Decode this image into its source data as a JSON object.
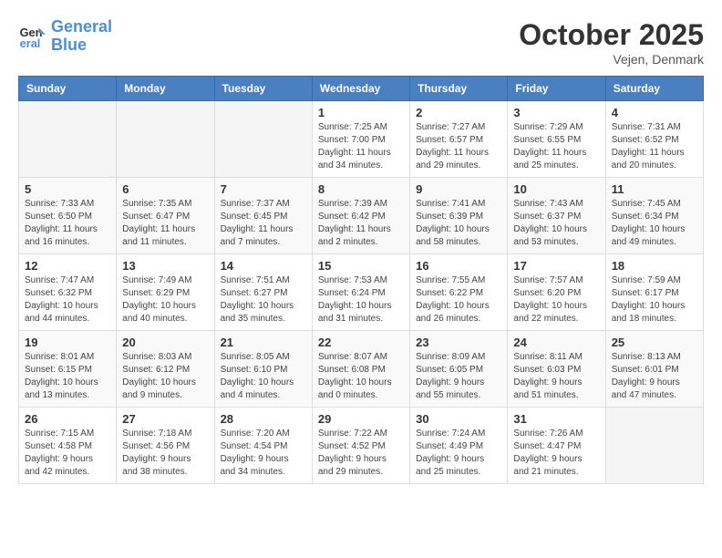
{
  "logo": {
    "line1": "General",
    "line2": "Blue"
  },
  "title": "October 2025",
  "location": "Vejen, Denmark",
  "days_header": [
    "Sunday",
    "Monday",
    "Tuesday",
    "Wednesday",
    "Thursday",
    "Friday",
    "Saturday"
  ],
  "weeks": [
    [
      {
        "day": "",
        "info": ""
      },
      {
        "day": "",
        "info": ""
      },
      {
        "day": "",
        "info": ""
      },
      {
        "day": "1",
        "info": "Sunrise: 7:25 AM\nSunset: 7:00 PM\nDaylight: 11 hours\nand 34 minutes."
      },
      {
        "day": "2",
        "info": "Sunrise: 7:27 AM\nSunset: 6:57 PM\nDaylight: 11 hours\nand 29 minutes."
      },
      {
        "day": "3",
        "info": "Sunrise: 7:29 AM\nSunset: 6:55 PM\nDaylight: 11 hours\nand 25 minutes."
      },
      {
        "day": "4",
        "info": "Sunrise: 7:31 AM\nSunset: 6:52 PM\nDaylight: 11 hours\nand 20 minutes."
      }
    ],
    [
      {
        "day": "5",
        "info": "Sunrise: 7:33 AM\nSunset: 6:50 PM\nDaylight: 11 hours\nand 16 minutes."
      },
      {
        "day": "6",
        "info": "Sunrise: 7:35 AM\nSunset: 6:47 PM\nDaylight: 11 hours\nand 11 minutes."
      },
      {
        "day": "7",
        "info": "Sunrise: 7:37 AM\nSunset: 6:45 PM\nDaylight: 11 hours\nand 7 minutes."
      },
      {
        "day": "8",
        "info": "Sunrise: 7:39 AM\nSunset: 6:42 PM\nDaylight: 11 hours\nand 2 minutes."
      },
      {
        "day": "9",
        "info": "Sunrise: 7:41 AM\nSunset: 6:39 PM\nDaylight: 10 hours\nand 58 minutes."
      },
      {
        "day": "10",
        "info": "Sunrise: 7:43 AM\nSunset: 6:37 PM\nDaylight: 10 hours\nand 53 minutes."
      },
      {
        "day": "11",
        "info": "Sunrise: 7:45 AM\nSunset: 6:34 PM\nDaylight: 10 hours\nand 49 minutes."
      }
    ],
    [
      {
        "day": "12",
        "info": "Sunrise: 7:47 AM\nSunset: 6:32 PM\nDaylight: 10 hours\nand 44 minutes."
      },
      {
        "day": "13",
        "info": "Sunrise: 7:49 AM\nSunset: 6:29 PM\nDaylight: 10 hours\nand 40 minutes."
      },
      {
        "day": "14",
        "info": "Sunrise: 7:51 AM\nSunset: 6:27 PM\nDaylight: 10 hours\nand 35 minutes."
      },
      {
        "day": "15",
        "info": "Sunrise: 7:53 AM\nSunset: 6:24 PM\nDaylight: 10 hours\nand 31 minutes."
      },
      {
        "day": "16",
        "info": "Sunrise: 7:55 AM\nSunset: 6:22 PM\nDaylight: 10 hours\nand 26 minutes."
      },
      {
        "day": "17",
        "info": "Sunrise: 7:57 AM\nSunset: 6:20 PM\nDaylight: 10 hours\nand 22 minutes."
      },
      {
        "day": "18",
        "info": "Sunrise: 7:59 AM\nSunset: 6:17 PM\nDaylight: 10 hours\nand 18 minutes."
      }
    ],
    [
      {
        "day": "19",
        "info": "Sunrise: 8:01 AM\nSunset: 6:15 PM\nDaylight: 10 hours\nand 13 minutes."
      },
      {
        "day": "20",
        "info": "Sunrise: 8:03 AM\nSunset: 6:12 PM\nDaylight: 10 hours\nand 9 minutes."
      },
      {
        "day": "21",
        "info": "Sunrise: 8:05 AM\nSunset: 6:10 PM\nDaylight: 10 hours\nand 4 minutes."
      },
      {
        "day": "22",
        "info": "Sunrise: 8:07 AM\nSunset: 6:08 PM\nDaylight: 10 hours\nand 0 minutes."
      },
      {
        "day": "23",
        "info": "Sunrise: 8:09 AM\nSunset: 6:05 PM\nDaylight: 9 hours\nand 55 minutes."
      },
      {
        "day": "24",
        "info": "Sunrise: 8:11 AM\nSunset: 6:03 PM\nDaylight: 9 hours\nand 51 minutes."
      },
      {
        "day": "25",
        "info": "Sunrise: 8:13 AM\nSunset: 6:01 PM\nDaylight: 9 hours\nand 47 minutes."
      }
    ],
    [
      {
        "day": "26",
        "info": "Sunrise: 7:15 AM\nSunset: 4:58 PM\nDaylight: 9 hours\nand 42 minutes."
      },
      {
        "day": "27",
        "info": "Sunrise: 7:18 AM\nSunset: 4:56 PM\nDaylight: 9 hours\nand 38 minutes."
      },
      {
        "day": "28",
        "info": "Sunrise: 7:20 AM\nSunset: 4:54 PM\nDaylight: 9 hours\nand 34 minutes."
      },
      {
        "day": "29",
        "info": "Sunrise: 7:22 AM\nSunset: 4:52 PM\nDaylight: 9 hours\nand 29 minutes."
      },
      {
        "day": "30",
        "info": "Sunrise: 7:24 AM\nSunset: 4:49 PM\nDaylight: 9 hours\nand 25 minutes."
      },
      {
        "day": "31",
        "info": "Sunrise: 7:26 AM\nSunset: 4:47 PM\nDaylight: 9 hours\nand 21 minutes."
      },
      {
        "day": "",
        "info": ""
      }
    ]
  ]
}
